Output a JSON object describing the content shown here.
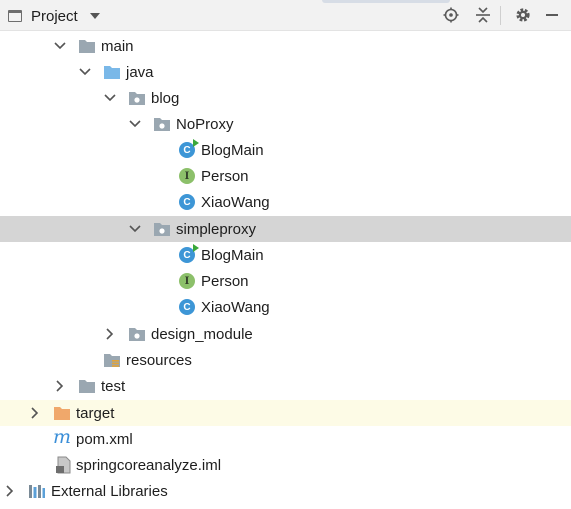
{
  "toolbar": {
    "title": "Project",
    "icons": [
      "window-icon",
      "dropdown-caret-icon",
      "locate-icon",
      "collapse-all-icon",
      "settings-gear-icon",
      "hide-minus-icon"
    ]
  },
  "tree": {
    "main": "main",
    "java": "java",
    "blog": "blog",
    "noproxy": "NoProxy",
    "noproxy_children": [
      "BlogMain",
      "Person",
      "XiaoWang"
    ],
    "simpleproxy": "simpleproxy",
    "simpleproxy_children": [
      "BlogMain",
      "Person",
      "XiaoWang"
    ],
    "design_module": "design_module",
    "resources": "resources",
    "test": "test",
    "target": "target",
    "pom": "pom.xml",
    "iml": "springcoreanalyze.iml",
    "external": "External Libraries",
    "class_letter": "C",
    "interface_letter": "I",
    "maven_letter": "m"
  },
  "colors": {
    "selected_row": "#d5d5d5",
    "target_row": "#fdfbe6",
    "class_icon": "#3d96d6",
    "interface_icon": "#8cc06a",
    "source_folder": "#7ab8e8",
    "excluded_folder": "#f0a86b"
  }
}
